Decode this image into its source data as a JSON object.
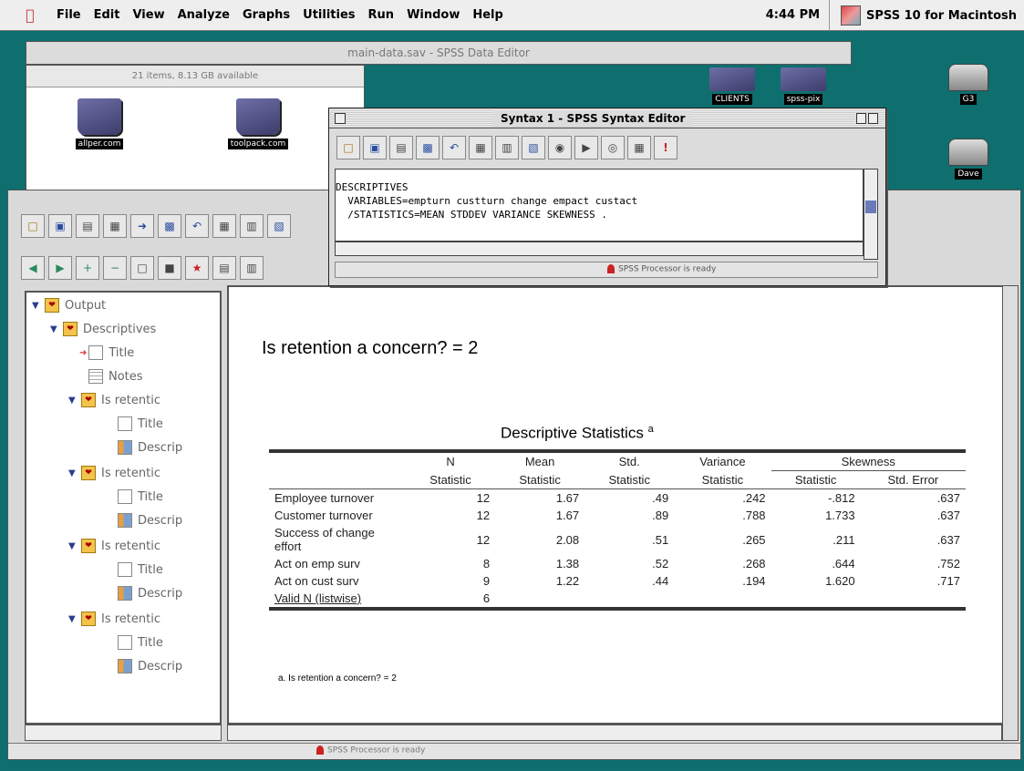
{
  "menubar": {
    "items": [
      "File",
      "Edit",
      "View",
      "Analyze",
      "Graphs",
      "Utilities",
      "Run",
      "Window",
      "Help"
    ],
    "clock": "4:44 PM",
    "app_name": "SPSS 10 for Macintosh"
  },
  "data_editor": {
    "title": "main-data.sav - SPSS Data Editor"
  },
  "finder": {
    "status": "21 items, 8.13 GB available",
    "icons": [
      "allper.com",
      "toolpack.com"
    ]
  },
  "desktop": {
    "icons": [
      "CLIENTS",
      "spss-pix",
      "G3",
      "Dave"
    ]
  },
  "syntax_editor": {
    "title": "Syntax 1 - SPSS Syntax Editor",
    "lines": [
      "DESCRIPTIVES",
      "  VARIABLES=empturn custturn change empact custact",
      "  /STATISTICS=MEAN STDDEV VARIANCE SKEWNESS ."
    ],
    "status": "SPSS Processor  is ready"
  },
  "viewer": {
    "status": "SPSS Processor  is ready",
    "outline": [
      {
        "label": "Output"
      },
      {
        "label": "Descriptives"
      },
      {
        "label": "Title"
      },
      {
        "label": "Notes"
      },
      {
        "label": "Is retentic"
      },
      {
        "label": "Title"
      },
      {
        "label": "Descrip"
      },
      {
        "label": "Is retentic"
      },
      {
        "label": "Title"
      },
      {
        "label": "Descrip"
      },
      {
        "label": "Is retentic"
      },
      {
        "label": "Title"
      },
      {
        "label": "Descrip"
      },
      {
        "label": "Is retentic"
      },
      {
        "label": "Title"
      },
      {
        "label": "Descrip"
      }
    ],
    "heading": "Is retention a concern? = 2",
    "table": {
      "title": "Descriptive Statistics",
      "title_sup": "a",
      "group_headers": [
        "N",
        "Mean",
        "Std.",
        "Variance",
        "Skewness"
      ],
      "sub_headers": [
        "Statistic",
        "Statistic",
        "Statistic",
        "Statistic",
        "Statistic",
        "Std. Error"
      ],
      "rows": [
        {
          "label": "Employee turnover",
          "n": "12",
          "mean": "1.67",
          "std": ".49",
          "variance": ".242",
          "skew": "-.812",
          "skew_se": ".637"
        },
        {
          "label": "Customer turnover",
          "n": "12",
          "mean": "1.67",
          "std": ".89",
          "variance": ".788",
          "skew": "1.733",
          "skew_se": ".637"
        },
        {
          "label": "Success of change effort",
          "n": "12",
          "mean": "2.08",
          "std": ".51",
          "variance": ".265",
          "skew": ".211",
          "skew_se": ".637"
        },
        {
          "label": "Act on emp surv",
          "n": "8",
          "mean": "1.38",
          "std": ".52",
          "variance": ".268",
          "skew": ".644",
          "skew_se": ".752"
        },
        {
          "label": "Act on cust surv",
          "n": "9",
          "mean": "1.22",
          "std": ".44",
          "variance": ".194",
          "skew": "1.620",
          "skew_se": ".717"
        },
        {
          "label": "Valid N (listwise)",
          "n": "6",
          "mean": "",
          "std": "",
          "variance": "",
          "skew": "",
          "skew_se": ""
        }
      ],
      "footnote": "a. Is retention a concern? = 2"
    }
  }
}
